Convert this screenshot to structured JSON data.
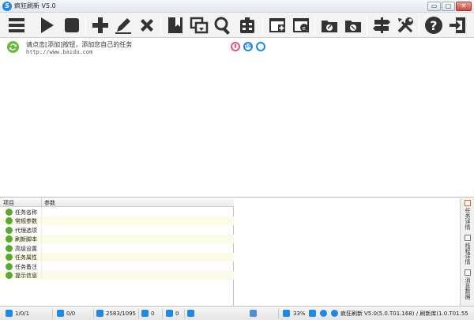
{
  "window": {
    "title": "疯狂刷新 V5.0",
    "logo_letter": "S",
    "min_label": "▭",
    "max_label": "▢",
    "close_label": "✕"
  },
  "toolbar": {
    "icons": [
      "menu-icon",
      "play-icon",
      "stop-icon",
      "add-icon",
      "edit-icon",
      "delete-icon",
      "bookmark-icon",
      "refresh-icon",
      "search-icon",
      "calculator-icon",
      "add-window-icon",
      "ie-icon",
      "folder-open-icon",
      "folder-save-icon",
      "sign-post-icon",
      "tools-icon",
      "help-icon",
      "exit-icon"
    ]
  },
  "task": {
    "hint": "请点击[添加]按钮，添加您自己的任务",
    "url": "http://www.baidu.com",
    "badge_mid": "10"
  },
  "grid": {
    "col_item": "项目",
    "col_param": "参数",
    "rows": [
      "任务名称",
      "常规参数",
      "代理选项",
      "刷新脚本",
      "高级设置",
      "任务属性",
      "任务备注",
      "提示信息"
    ]
  },
  "side_tabs": [
    "任务详情",
    "线程详情",
    "消息数据"
  ],
  "status": {
    "pages": "1/0/1",
    "threads": "0/0",
    "counts": "2583/1095",
    "down": "0",
    "errors": "0",
    "zoom": "33%",
    "app_name": "疯狂刷新",
    "version": "V5.0(5.0.T01.168) / 刷新库(1.0.T01.55"
  },
  "colors": {
    "accent_green": "#5aa832",
    "accent_blue": "#1e88e5",
    "badge_pink": "#d9588a"
  }
}
